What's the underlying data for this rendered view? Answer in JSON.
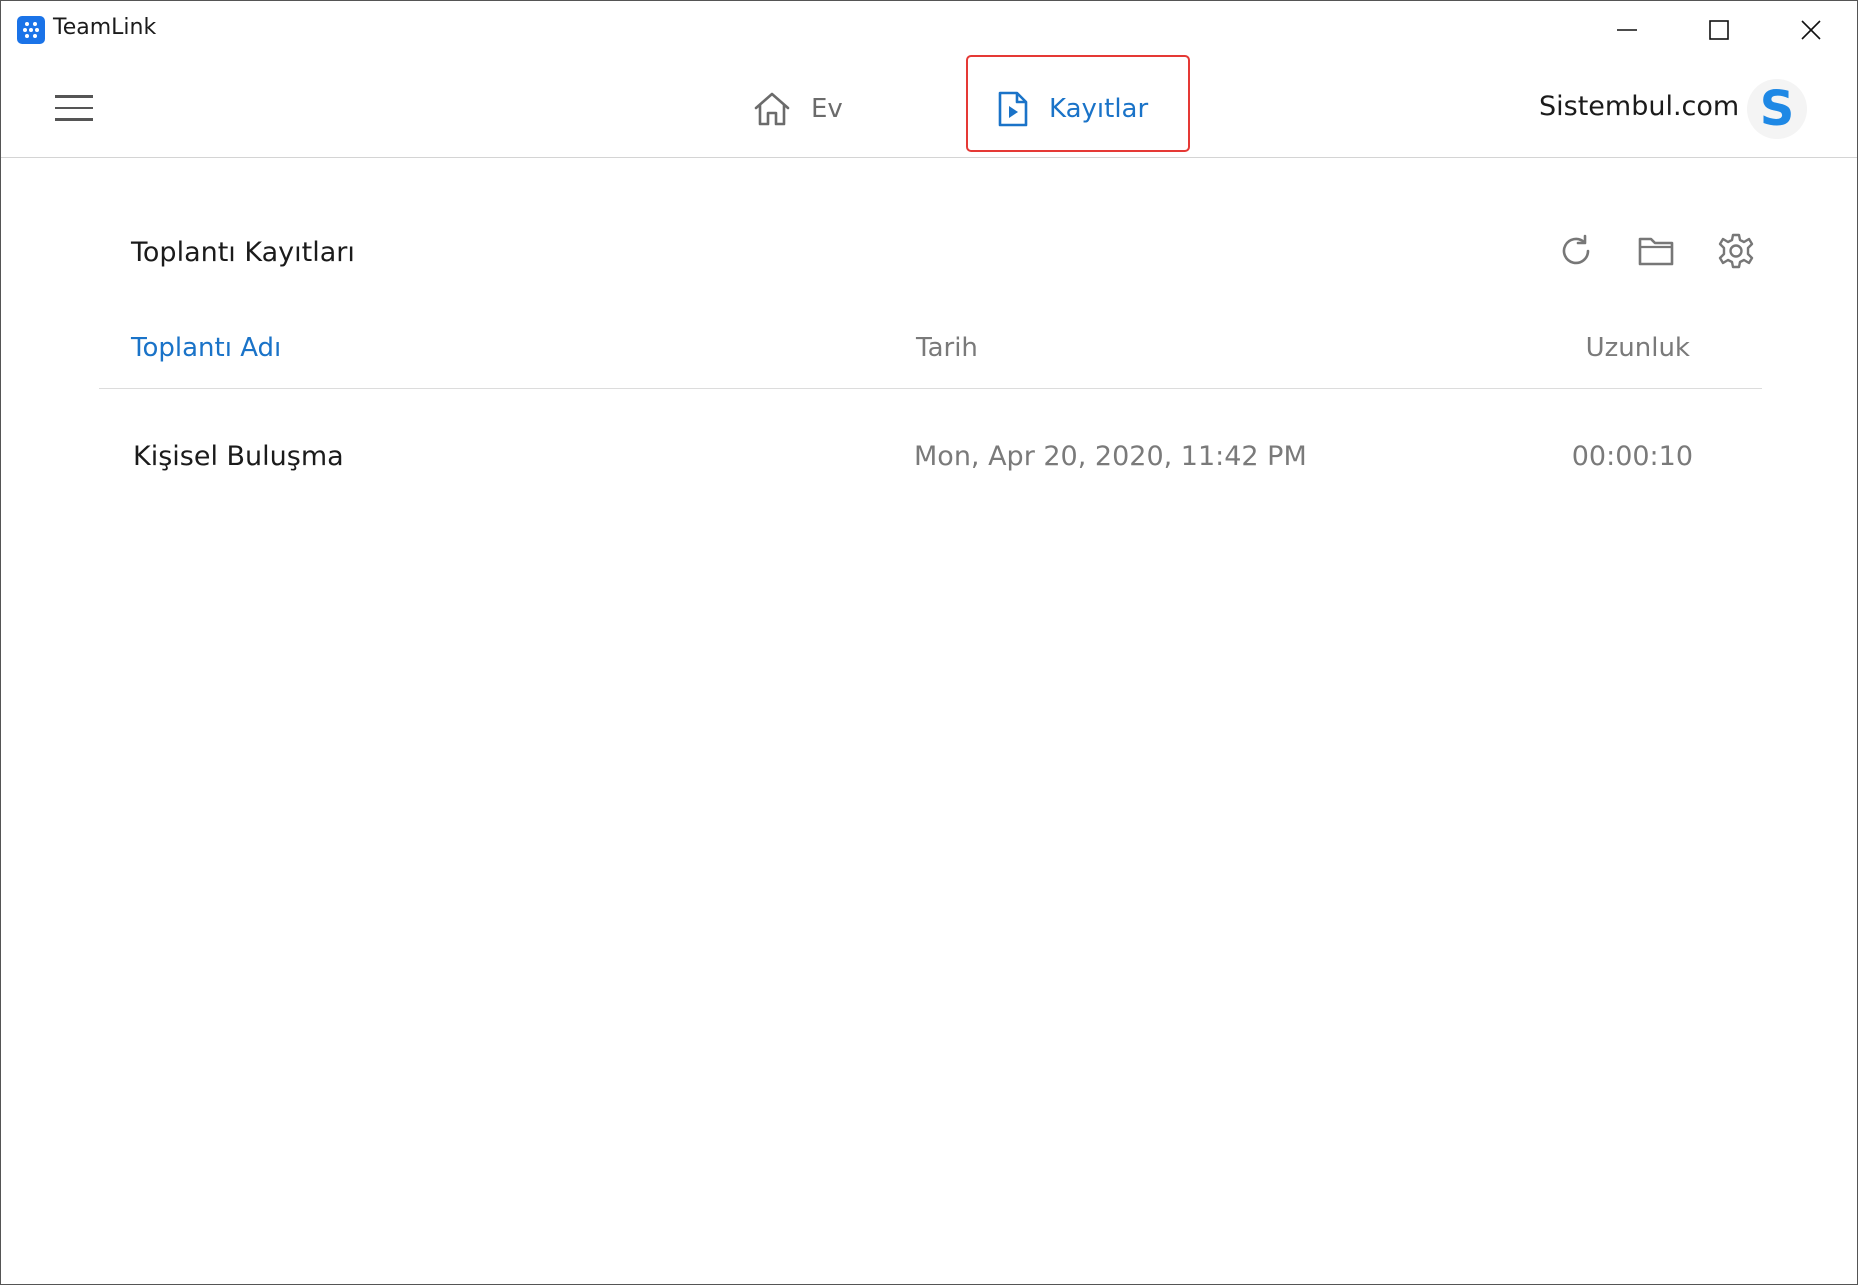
{
  "window": {
    "title": "TeamLink"
  },
  "nav": {
    "tabs": [
      {
        "label": "Ev",
        "icon": "home-icon",
        "active": false
      },
      {
        "label": "Kayıtlar",
        "icon": "recording-file-icon",
        "active": true
      }
    ],
    "account_name": "Sistembul.com",
    "avatar_letter": "S"
  },
  "recordings": {
    "title": "Toplantı Kayıtları",
    "toolbar": [
      "refresh-icon",
      "folder-icon",
      "settings-icon"
    ],
    "columns": {
      "name": "Toplantı Adı",
      "date": "Tarih",
      "length": "Uzunluk"
    },
    "rows": [
      {
        "name": "Kişisel Buluşma",
        "date": "Mon, Apr 20, 2020, 11:42 PM",
        "length": "00:00:10"
      }
    ]
  },
  "colors": {
    "accent": "#1a73c8",
    "highlight_border": "#e53935",
    "avatar_letter": "#1e88e5"
  }
}
